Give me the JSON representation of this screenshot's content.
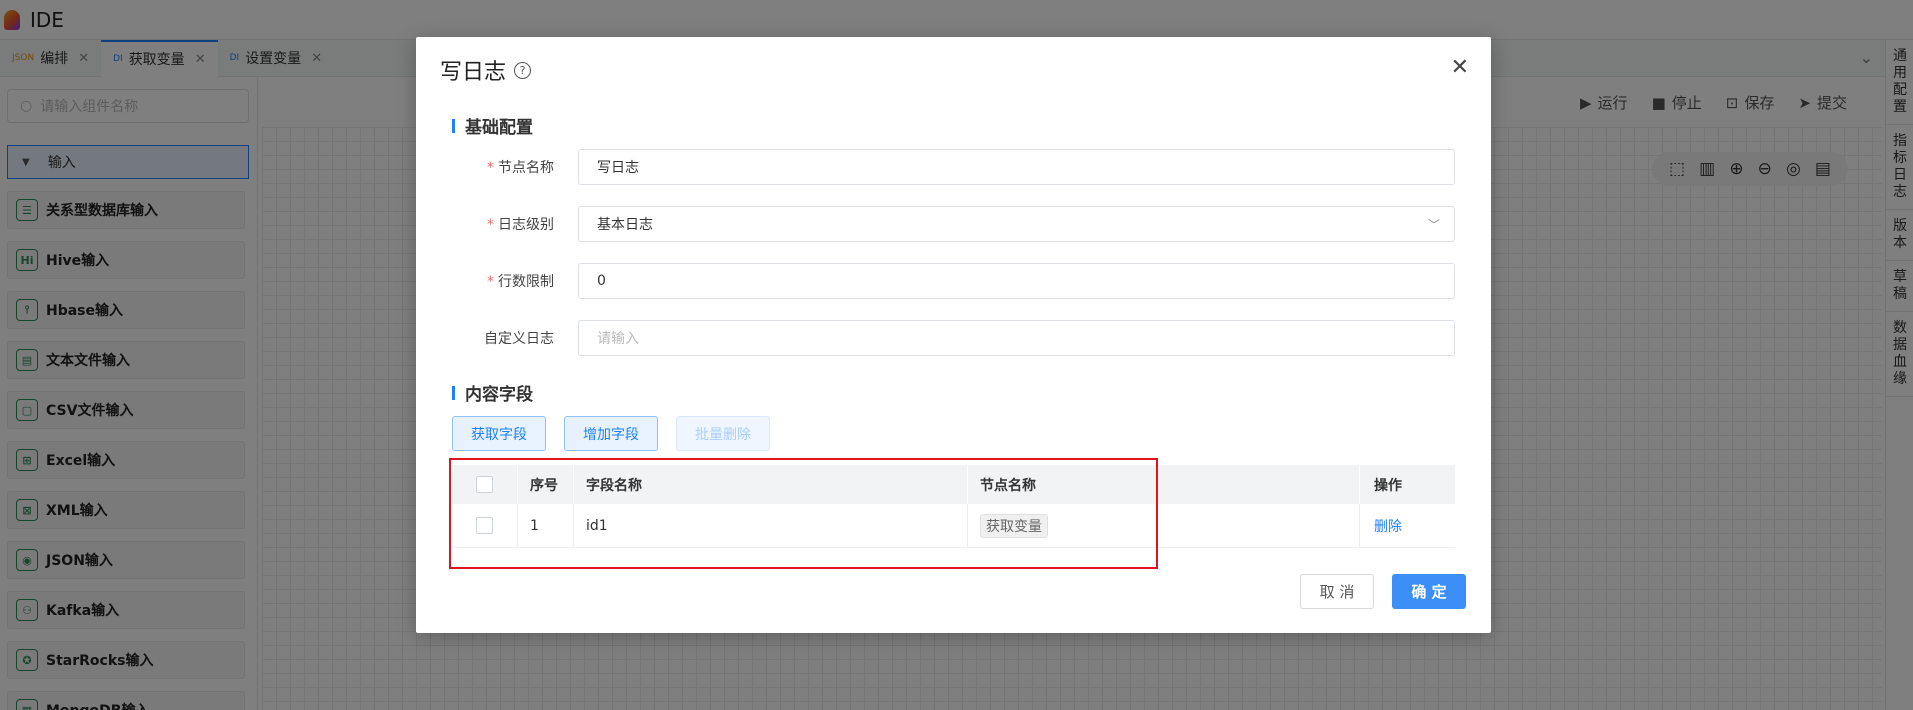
{
  "app": {
    "title": "IDE"
  },
  "tabs": [
    {
      "icon": "JSON",
      "label": "编排"
    },
    {
      "icon": "DI",
      "label": "获取变量"
    },
    {
      "icon": "DI",
      "label": "设置变量"
    }
  ],
  "sidebar": {
    "search_placeholder": "请输入组件名称",
    "group_label": "输入",
    "components": [
      {
        "icon": "☰",
        "label": "关系型数据库输入"
      },
      {
        "icon": "Hi",
        "label": "Hive输入"
      },
      {
        "icon": "⫯",
        "label": "Hbase输入"
      },
      {
        "icon": "▤",
        "label": "文本文件输入"
      },
      {
        "icon": "▢",
        "label": "CSV文件输入"
      },
      {
        "icon": "⊞",
        "label": "Excel输入"
      },
      {
        "icon": "⊠",
        "label": "XML输入"
      },
      {
        "icon": "◉",
        "label": "JSON输入"
      },
      {
        "icon": "⚇",
        "label": "Kafka输入"
      },
      {
        "icon": "✪",
        "label": "StarRocks输入"
      },
      {
        "icon": "▦",
        "label": "MongoDB输入"
      }
    ]
  },
  "toolbar": {
    "run": "运行",
    "stop": "停止",
    "save": "保存",
    "submit": "提交"
  },
  "right_rail": [
    "通用配置",
    "指标日志",
    "版本",
    "草稿",
    "数据血缘"
  ],
  "modal": {
    "title": "写日志",
    "section_basic": "基础配置",
    "section_fields": "内容字段",
    "form": {
      "node_name_label": "节点名称",
      "node_name_value": "写日志",
      "log_level_label": "日志级别",
      "log_level_value": "基本日志",
      "row_limit_label": "行数限制",
      "row_limit_value": "0",
      "custom_log_label": "自定义日志",
      "custom_log_placeholder": "请输入"
    },
    "buttons": {
      "get_fields": "获取字段",
      "add_field": "增加字段",
      "batch_delete": "批量删除"
    },
    "table": {
      "headers": {
        "no": "序号",
        "field_name": "字段名称",
        "node_name": "节点名称",
        "action": "操作"
      },
      "rows": [
        {
          "no": "1",
          "field_name": "id1",
          "node_name": "获取变量",
          "action": "删除"
        }
      ]
    },
    "footer": {
      "cancel": "取 消",
      "ok": "确 定"
    }
  },
  "colors": {
    "accent": "#1e80ff",
    "highlight": "#e0141e",
    "required": "#f56c6c"
  }
}
